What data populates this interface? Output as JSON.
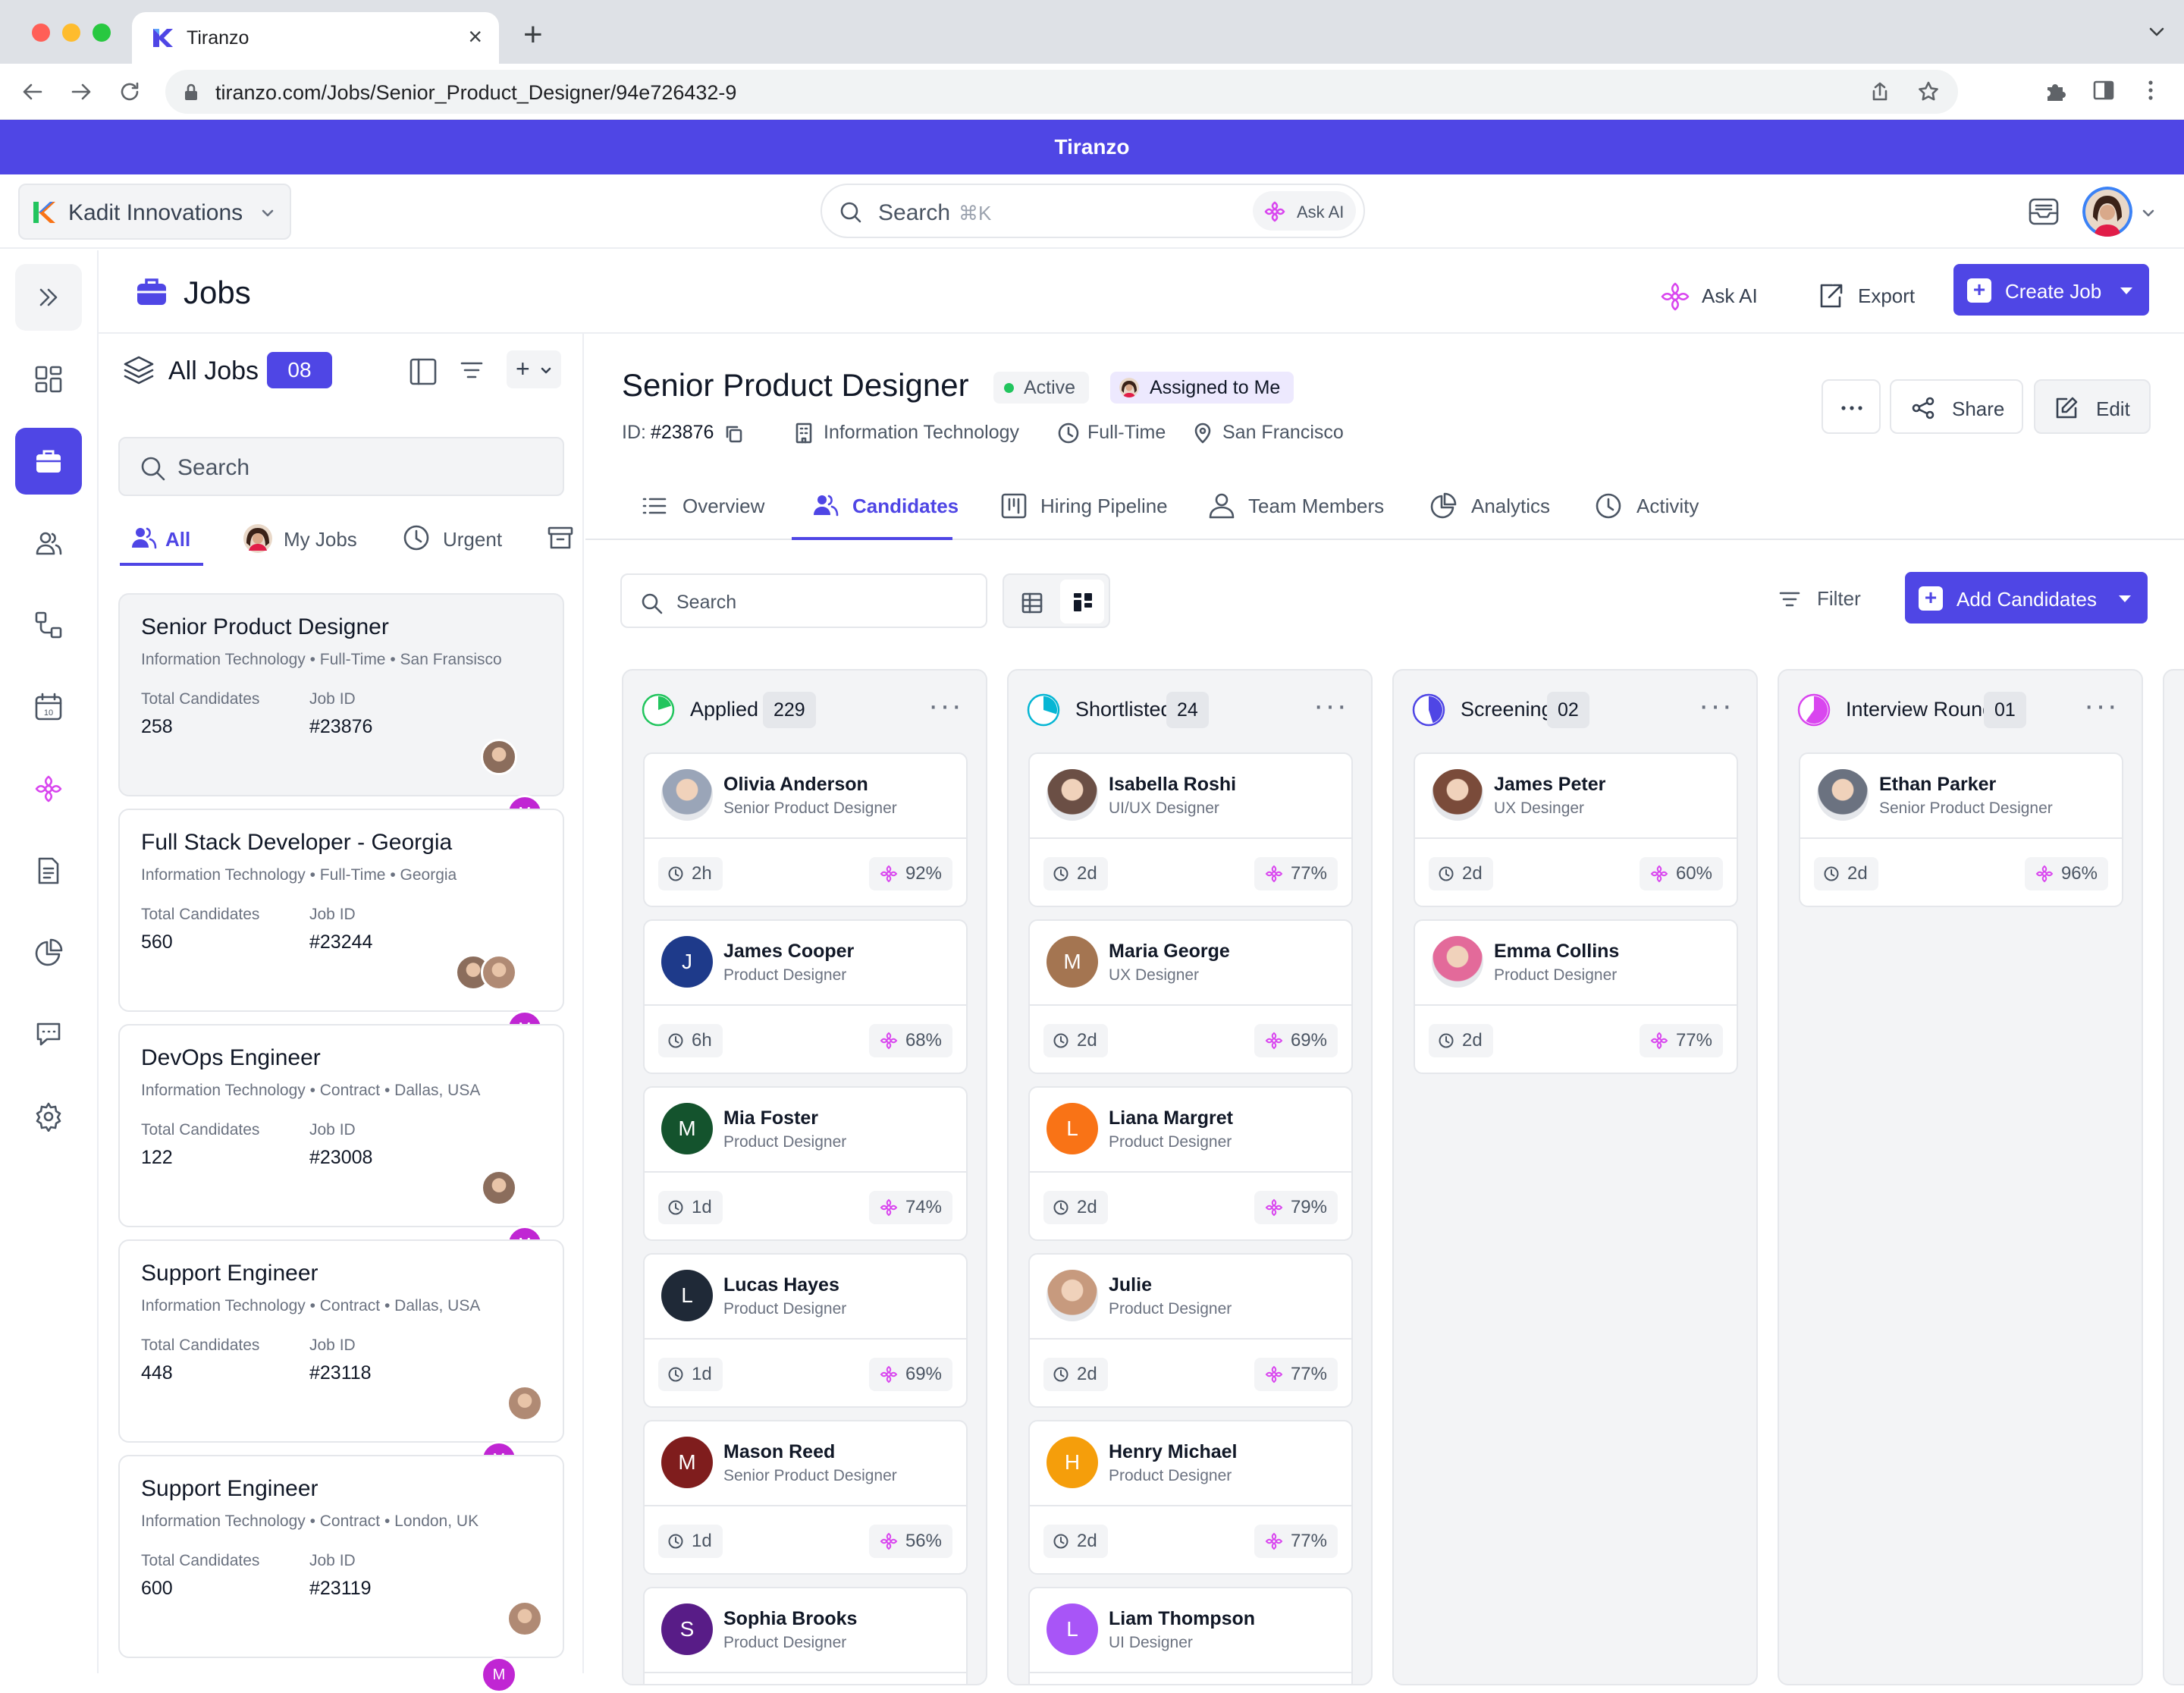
{
  "browser": {
    "tab_title": "Tiranzo",
    "url": "tiranzo.com/Jobs/Senior_Product_Designer/94e726432-9"
  },
  "banner": {
    "title": "Tiranzo"
  },
  "topbar": {
    "org_name": "Kadit Innovations",
    "search_placeholder": "Search",
    "search_shortcut": "⌘K",
    "ask_ai": "Ask AI"
  },
  "page": {
    "title": "Jobs",
    "ask_ai": "Ask AI",
    "export": "Export",
    "create_job": "Create Job"
  },
  "sidebar": {
    "icons": [
      "dashboard-icon",
      "briefcase-icon",
      "users-icon",
      "workflow-icon",
      "calendar-icon",
      "ai-flower-icon",
      "document-icon",
      "pie-chart-icon",
      "chat-icon",
      "gear-icon"
    ],
    "active": "briefcase-icon",
    "calendar_day": "10"
  },
  "jobs_panel": {
    "title": "All Jobs",
    "count": "08",
    "search_placeholder": "Search",
    "tabs": [
      {
        "label": "All",
        "active": true
      },
      {
        "label": "My Jobs",
        "active": false
      },
      {
        "label": "Urgent",
        "active": false
      }
    ],
    "jobs": [
      {
        "title": "Senior Product Designer",
        "meta": "Information Technology • Full-Time • San Fransisco",
        "total_label": "Total Candidates",
        "total": "258",
        "id_label": "Job ID",
        "id": "#23876",
        "selected": true
      },
      {
        "title": "Full Stack Developer - Georgia",
        "meta": "Information Technology • Full-Time • Georgia",
        "total_label": "Total Candidates",
        "total": "560",
        "id_label": "Job ID",
        "id": "#23244",
        "selected": false
      },
      {
        "title": "DevOps Engineer",
        "meta": "Information Technology • Contract • Dallas, USA",
        "total_label": "Total Candidates",
        "total": "122",
        "id_label": "Job ID",
        "id": "#23008",
        "selected": false
      },
      {
        "title": "Support Engineer",
        "meta": "Information Technology • Contract • Dallas, USA",
        "total_label": "Total Candidates",
        "total": "448",
        "id_label": "Job ID",
        "id": "#23118",
        "selected": false
      },
      {
        "title": "Support Engineer",
        "meta": "Information Technology • Contract • London, UK",
        "total_label": "Total Candidates",
        "total": "600",
        "id_label": "Job ID",
        "id": "#23119",
        "selected": false
      }
    ],
    "avatar_initial": "M"
  },
  "job_detail": {
    "title": "Senior Product Designer",
    "status": "Active",
    "assigned": "Assigned to Me",
    "id_label": "ID:",
    "id": "#23876",
    "department": "Information Technology",
    "employment": "Full-Time",
    "location": "San Francisco",
    "share": "Share",
    "edit": "Edit",
    "tabs": [
      {
        "label": "Overview",
        "icon": "list-icon",
        "active": false
      },
      {
        "label": "Candidates",
        "icon": "users-icon",
        "active": true
      },
      {
        "label": "Hiring Pipeline",
        "icon": "columns-icon",
        "active": false
      },
      {
        "label": "Team Members",
        "icon": "user-icon",
        "active": false
      },
      {
        "label": "Analytics",
        "icon": "pie-chart-icon",
        "active": false
      },
      {
        "label": "Activity",
        "icon": "clock-icon",
        "active": false
      }
    ],
    "search_placeholder": "Search",
    "filter": "Filter",
    "add_candidates": "Add Candidates"
  },
  "colors": {
    "accent": "#4f46e5",
    "ai": "#d946ef",
    "active_dot": "#22c55e"
  },
  "pipeline": [
    {
      "name": "Applied",
      "count": "229",
      "ring_color": "#22c55e",
      "fill": 0.2,
      "candidates": [
        {
          "name": "Olivia Anderson",
          "role": "Senior Product Designer",
          "time": "2h",
          "score": "92%",
          "initial": "",
          "color": "#9aa5b8"
        },
        {
          "name": "James Cooper",
          "role": "Product Designer",
          "time": "6h",
          "score": "68%",
          "initial": "J",
          "color": "#1e3a8a"
        },
        {
          "name": "Mia Foster",
          "role": "Product Designer",
          "time": "1d",
          "score": "74%",
          "initial": "M",
          "color": "#14532d"
        },
        {
          "name": "Lucas Hayes",
          "role": "Product Designer",
          "time": "1d",
          "score": "69%",
          "initial": "L",
          "color": "#1f2937"
        },
        {
          "name": "Mason Reed",
          "role": "Senior Product Designer",
          "time": "1d",
          "score": "56%",
          "initial": "M",
          "color": "#7f1d1d"
        },
        {
          "name": "Sophia Brooks",
          "role": "Product Designer",
          "time": "",
          "score": "",
          "initial": "S",
          "color": "#581c87"
        }
      ]
    },
    {
      "name": "Shortlisted",
      "count": "24",
      "ring_color": "#06b6d4",
      "fill": 0.3,
      "candidates": [
        {
          "name": "Isabella Roshi",
          "role": "UI/UX Designer",
          "time": "2d",
          "score": "77%",
          "initial": "",
          "color": "#6b4f45"
        },
        {
          "name": "Maria George",
          "role": "UX Designer",
          "time": "2d",
          "score": "69%",
          "initial": "M",
          "color": "#a47551"
        },
        {
          "name": "Liana Margret",
          "role": "Product Designer",
          "time": "2d",
          "score": "79%",
          "initial": "L",
          "color": "#f97316"
        },
        {
          "name": "Julie",
          "role": "Product Designer",
          "time": "2d",
          "score": "77%",
          "initial": "",
          "color": "#c79a7e"
        },
        {
          "name": "Henry Michael",
          "role": "Product Designer",
          "time": "2d",
          "score": "77%",
          "initial": "H",
          "color": "#f59e0b"
        },
        {
          "name": "Liam Thompson",
          "role": "UI Designer",
          "time": "",
          "score": "",
          "initial": "L",
          "color": "#a855f7"
        }
      ]
    },
    {
      "name": "Screening",
      "count": "02",
      "ring_color": "#4f46e5",
      "fill": 0.45,
      "candidates": [
        {
          "name": "James Peter",
          "role": "UX Desinger",
          "time": "2d",
          "score": "60%",
          "initial": "",
          "color": "#7a4b3a"
        },
        {
          "name": "Emma Collins",
          "role": "Product Designer",
          "time": "2d",
          "score": "77%",
          "initial": "",
          "color": "#e36a9a"
        }
      ]
    },
    {
      "name": "Interview Round",
      "count": "01",
      "ring_color": "#d946ef",
      "fill": 0.6,
      "candidates": [
        {
          "name": "Ethan Parker",
          "role": "Senior Product Designer",
          "time": "2d",
          "score": "96%",
          "initial": "",
          "color": "#6b7280"
        }
      ]
    }
  ]
}
